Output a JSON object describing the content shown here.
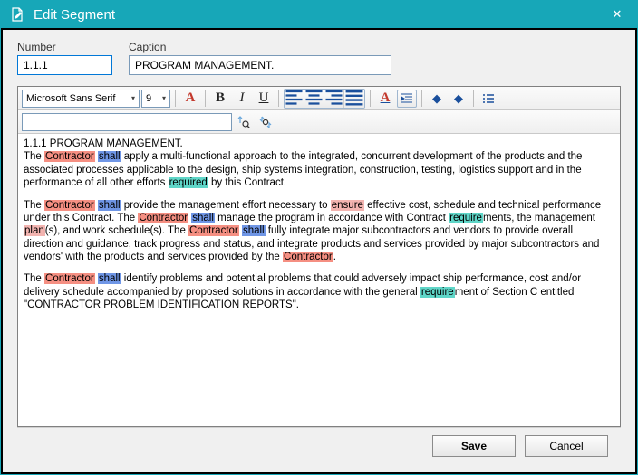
{
  "titlebar": {
    "title": "Edit Segment"
  },
  "fields": {
    "number_label": "Number",
    "number_value": "1.1.1",
    "caption_label": "Caption",
    "caption_value": "PROGRAM MANAGEMENT."
  },
  "toolbar": {
    "font_name": "Microsoft Sans Serif",
    "font_size": "9",
    "search_value": ""
  },
  "doc": {
    "heading": "1.1.1  PROGRAM MANAGEMENT.",
    "p1_a": "The ",
    "p1_contractor": "Contractor",
    "p1_b": " ",
    "p1_shall": "shall",
    "p1_c": " apply a multi-functional approach to the integrated, concurrent development of the products and the associated processes applicable to the design, ship systems integration, construction, testing, logistics support and in the performance of all other efforts ",
    "p1_required": "required",
    "p1_d": " by this Contract.",
    "p2_a": "The ",
    "p2_contractor1": "Contractor",
    "p2_b": " ",
    "p2_shall1": "shall",
    "p2_c": " provide the management effort necessary to ",
    "p2_ensure": "ensure",
    "p2_d": " effective cost, schedule and technical performance under this Contract.  The ",
    "p2_contractor2": "Contractor",
    "p2_e": " ",
    "p2_shall2": "shall",
    "p2_f": " manage the program in accordance with Contract ",
    "p2_require": "require",
    "p2_g": "ments, the management ",
    "p2_plan": "plan",
    "p2_h": "(s), and work schedule(s).  The ",
    "p2_contractor3": "Contractor",
    "p2_i": " ",
    "p2_shall3": "shall",
    "p2_j": " fully integrate major subcontractors and vendors to provide overall direction and guidance, track progress and status, and integrate products and services provided by major subcontractors and vendors' with the products and services provided by the ",
    "p2_contractor4": "Contractor",
    "p2_k": ".",
    "p3_a": "The ",
    "p3_contractor": "Contractor",
    "p3_b": " ",
    "p3_shall": "shall",
    "p3_c": " identify problems and potential problems that could adversely impact ship performance, cost and/or delivery schedule accompanied by proposed solutions in accordance with the general ",
    "p3_require": "require",
    "p3_d": "ment of Section C entitled \"CONTRACTOR PROBLEM IDENTIFICATION REPORTS\"."
  },
  "footer": {
    "save": "Save",
    "cancel": "Cancel"
  }
}
